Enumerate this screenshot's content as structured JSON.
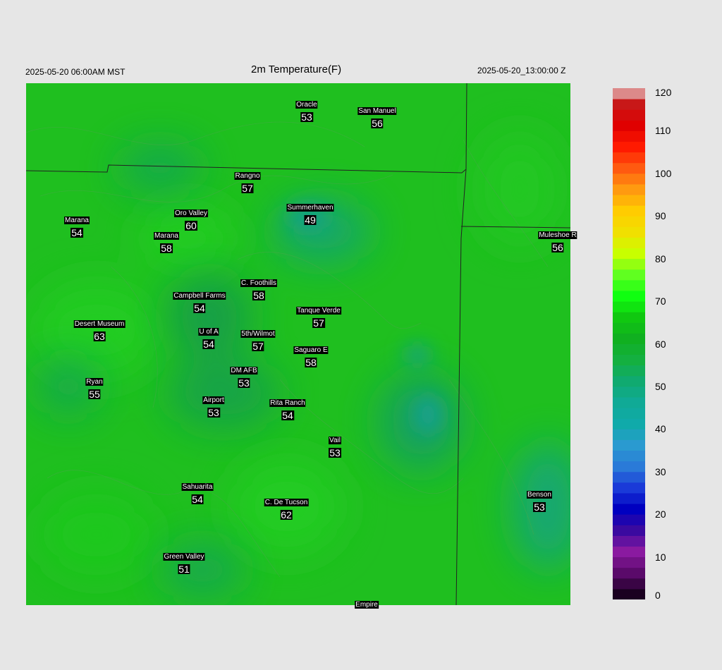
{
  "header": {
    "valid_time": "2025-05-20 06:00AM MST",
    "title": "2m Temperature(F)",
    "init_time": "2025-05-20_13:00:00 Z"
  },
  "colors": {
    "background": "#e6e6e6",
    "map_base": "#1fbf1f",
    "cool_zone": "#16a66e",
    "boundary": "#222222"
  },
  "stations": [
    {
      "id": "oracle",
      "name": "Oracle",
      "temp": "53"
    },
    {
      "id": "san-manuel",
      "name": "San Manuel",
      "temp": "56"
    },
    {
      "id": "rangno",
      "name": "Rangno",
      "temp": "57"
    },
    {
      "id": "summerhaven",
      "name": "Summerhaven",
      "temp": "49"
    },
    {
      "id": "marana-west",
      "name": "Marana",
      "temp": "54"
    },
    {
      "id": "oro-valley",
      "name": "Oro Valley",
      "temp": "60"
    },
    {
      "id": "marana",
      "name": "Marana",
      "temp": "58"
    },
    {
      "id": "muleshoe",
      "name": "Muleshoe R",
      "temp": "56"
    },
    {
      "id": "c-foothills",
      "name": "C. Foothills",
      "temp": "58"
    },
    {
      "id": "campbell-farms",
      "name": "Campbell Farms",
      "temp": "54"
    },
    {
      "id": "tanque-verde",
      "name": "Tanque Verde",
      "temp": "57"
    },
    {
      "id": "desert-museum",
      "name": "Desert Museum",
      "temp": "63"
    },
    {
      "id": "u-of-a",
      "name": "U of A",
      "temp": "54"
    },
    {
      "id": "5th-wilmot",
      "name": "5th/Wilmot",
      "temp": "57"
    },
    {
      "id": "saguaro-e",
      "name": "Saguaro E",
      "temp": "58"
    },
    {
      "id": "dm-afb",
      "name": "DM AFB",
      "temp": "53"
    },
    {
      "id": "ryan",
      "name": "Ryan",
      "temp": "55"
    },
    {
      "id": "airport",
      "name": "Airport",
      "temp": "53"
    },
    {
      "id": "rita-ranch",
      "name": "Rita Ranch",
      "temp": "54"
    },
    {
      "id": "vail",
      "name": "Vail",
      "temp": "53"
    },
    {
      "id": "sahuarita",
      "name": "Sahuarita",
      "temp": "54"
    },
    {
      "id": "c-de-tucson",
      "name": "C. De Tucson",
      "temp": "62"
    },
    {
      "id": "benson",
      "name": "Benson",
      "temp": "53"
    },
    {
      "id": "green-valley",
      "name": "Green Valley",
      "temp": "51"
    },
    {
      "id": "empire",
      "name": "Empire",
      "temp": ""
    }
  ],
  "colorbar": {
    "ticks": [
      "120",
      "110",
      "100",
      "90",
      "80",
      "70",
      "60",
      "50",
      "40",
      "30",
      "20",
      "10",
      "0"
    ],
    "min": 0,
    "max": 120,
    "stops": [
      {
        "value": 0,
        "color": "#1a0020"
      },
      {
        "value": 5,
        "color": "#5a0a6a"
      },
      {
        "value": 10,
        "color": "#8a1aa0"
      },
      {
        "value": 15,
        "color": "#3a0aa0"
      },
      {
        "value": 20,
        "color": "#0000c0"
      },
      {
        "value": 25,
        "color": "#1a3ad8"
      },
      {
        "value": 30,
        "color": "#2a7ad8"
      },
      {
        "value": 35,
        "color": "#2a9ad0"
      },
      {
        "value": 40,
        "color": "#10aaaa"
      },
      {
        "value": 45,
        "color": "#10aa96"
      },
      {
        "value": 50,
        "color": "#10aa70"
      },
      {
        "value": 55,
        "color": "#14b040"
      },
      {
        "value": 60,
        "color": "#10b020"
      },
      {
        "value": 65,
        "color": "#10c810"
      },
      {
        "value": 70,
        "color": "#10ff10"
      },
      {
        "value": 75,
        "color": "#60ff20"
      },
      {
        "value": 80,
        "color": "#c8ff00"
      },
      {
        "value": 85,
        "color": "#f0e000"
      },
      {
        "value": 90,
        "color": "#ffcc00"
      },
      {
        "value": 95,
        "color": "#ff9a10"
      },
      {
        "value": 100,
        "color": "#ff5a10"
      },
      {
        "value": 105,
        "color": "#ff1a00"
      },
      {
        "value": 110,
        "color": "#e00000"
      },
      {
        "value": 115,
        "color": "#c81818"
      },
      {
        "value": 118,
        "color": "#e0a0a0"
      },
      {
        "value": 120,
        "color": "#dcdcdc"
      }
    ]
  }
}
